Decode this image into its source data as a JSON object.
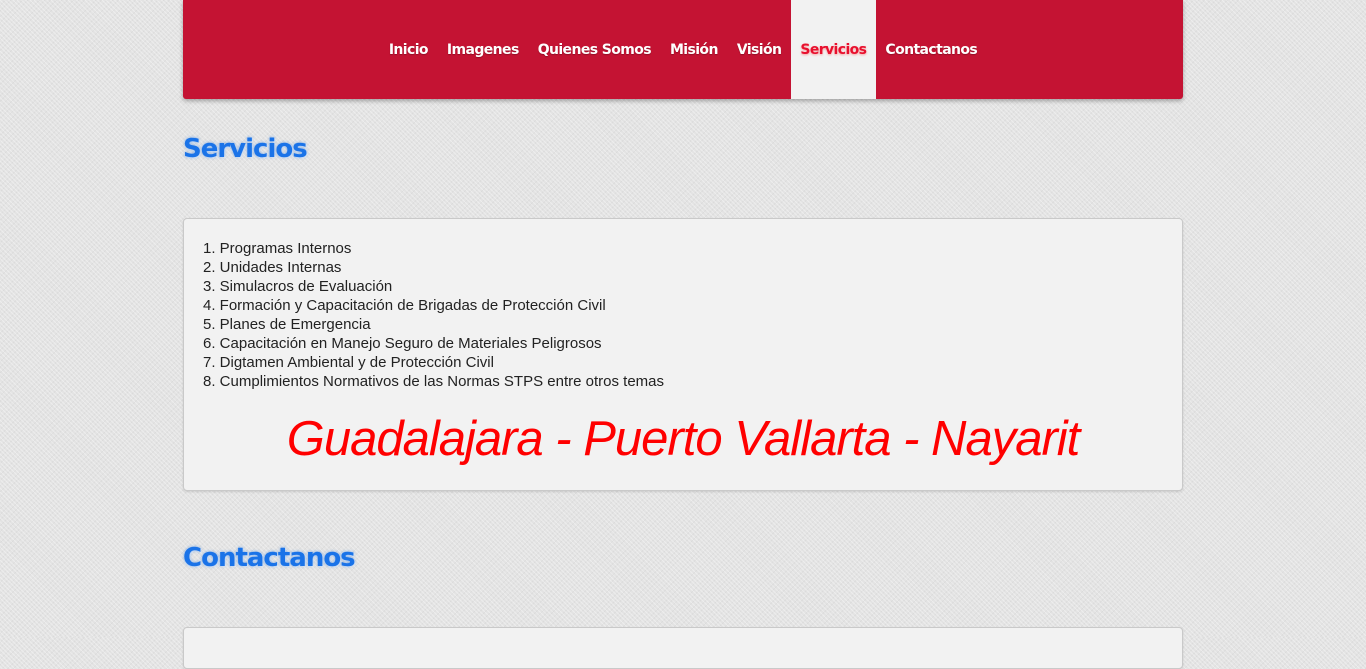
{
  "nav": {
    "items": [
      {
        "label": "Inicio"
      },
      {
        "label": "Imagenes"
      },
      {
        "label": "Quienes Somos"
      },
      {
        "label": "Misión"
      },
      {
        "label": "Visión"
      },
      {
        "label": "Servicios"
      },
      {
        "label": "Contactanos"
      }
    ],
    "active": "Servicios",
    "background_color": "#c41333",
    "active_text_color": "#e8102e"
  },
  "services": {
    "title": "Servicios",
    "items": [
      "1. Programas Internos",
      "2. Unidades Internas",
      "3. Simulacros de Evaluación",
      "4. Formación y Capacitación de Brigadas de Protección Civil",
      "5. Planes de Emergencia",
      "6. Capacitación en Manejo Seguro de Materiales Peligrosos",
      "7. Digtamen Ambiental y de Protección Civil",
      "8. Cumplimientos Normativos de las Normas STPS entre otros temas"
    ],
    "tagline": "Guadalajara - Puerto Vallarta - Nayarit",
    "tagline_color": "#ff0000"
  },
  "contact": {
    "title": "Contactanos"
  },
  "colors": {
    "heading": "#1a73e8",
    "panel_background": "#f2f2f2"
  }
}
